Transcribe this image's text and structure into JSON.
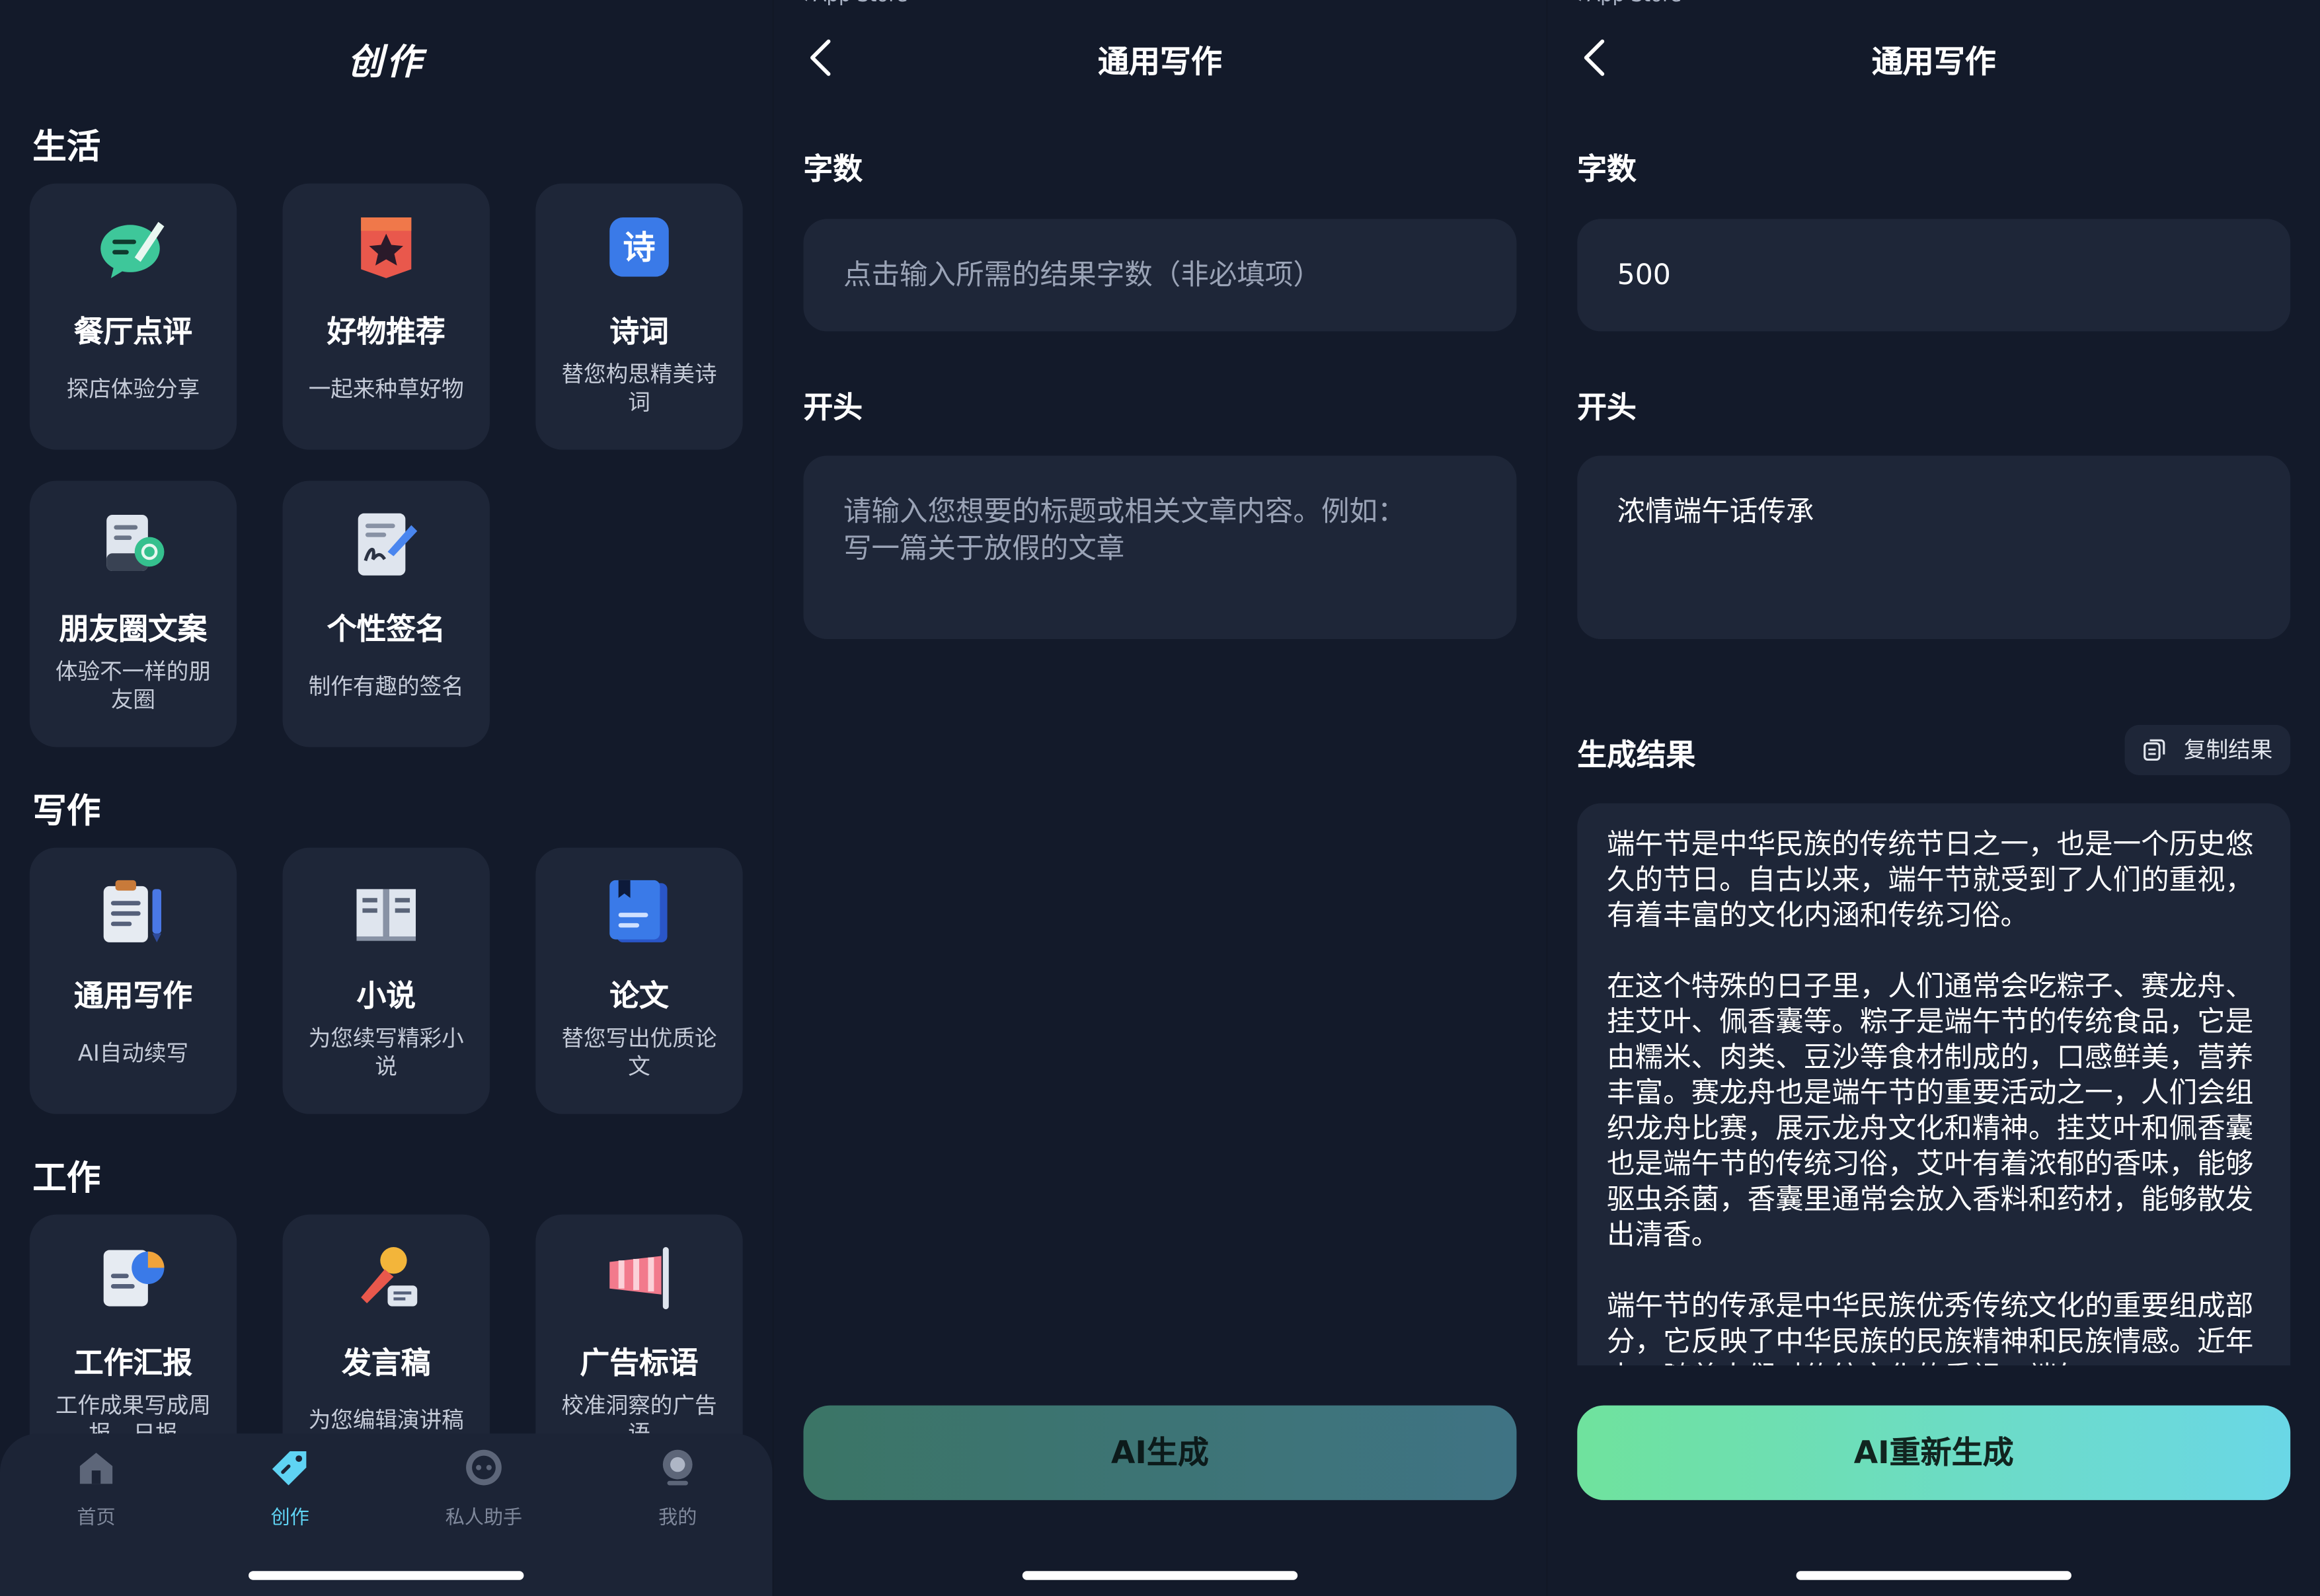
{
  "status": {
    "back_app": "App Store"
  },
  "create_page": {
    "title": "创作",
    "sections": [
      {
        "title": "生活",
        "cards": [
          {
            "title": "餐厅点评",
            "subtitle": "探店体验分享",
            "icon": "chat-edit-icon"
          },
          {
            "title": "好物推荐",
            "subtitle": "一起来种草好物",
            "icon": "star-badge-icon"
          },
          {
            "title": "诗词",
            "subtitle": "替您构思精美诗词",
            "icon": "poem-icon"
          },
          {
            "title": "朋友圈文案",
            "subtitle": "体验不一样的朋友圈",
            "icon": "moments-doc-icon"
          },
          {
            "title": "个性签名",
            "subtitle": "制作有趣的签名",
            "icon": "signature-icon"
          }
        ]
      },
      {
        "title": "写作",
        "cards": [
          {
            "title": "通用写作",
            "subtitle": "AI自动续写",
            "icon": "clipboard-pen-icon"
          },
          {
            "title": "小说",
            "subtitle": "为您续写精彩小说",
            "icon": "open-book-icon"
          },
          {
            "title": "论文",
            "subtitle": "替您写出优质论文",
            "icon": "thesis-book-icon"
          }
        ]
      },
      {
        "title": "工作",
        "cards": [
          {
            "title": "工作汇报",
            "subtitle": "工作成果写成周报、日报",
            "icon": "report-chart-icon"
          },
          {
            "title": "发言稿",
            "subtitle": "为您编辑演讲稿",
            "icon": "microphone-icon"
          },
          {
            "title": "广告标语",
            "subtitle": "校准洞察的广告语",
            "icon": "banner-flag-icon"
          }
        ]
      }
    ],
    "tabs": [
      {
        "label": "首页",
        "icon": "home-icon"
      },
      {
        "label": "创作",
        "icon": "tag-icon",
        "active": true
      },
      {
        "label": "私人助手",
        "icon": "robot-icon"
      },
      {
        "label": "我的",
        "icon": "profile-icon"
      }
    ]
  },
  "writing_empty": {
    "title": "通用写作",
    "word_count_label": "字数",
    "word_count_placeholder": "点击输入所需的结果字数（非必填项）",
    "opening_label": "开头",
    "opening_placeholder_1": "请输入您想要的标题或相关文章内容。例如：",
    "opening_placeholder_2": "写一篇关于放假的文章",
    "generate_button": "AI生成"
  },
  "writing_result": {
    "title": "通用写作",
    "word_count_label": "字数",
    "word_count_value": "500",
    "opening_label": "开头",
    "opening_value": "浓情端午话传承",
    "result_label": "生成结果",
    "copy_button": "复制结果",
    "paragraphs": [
      "端午节是中华民族的传统节日之一，也是一个历史悠久的节日。自古以来，端午节就受到了人们的重视，有着丰富的文化内涵和传统习俗。",
      "在这个特殊的日子里，人们通常会吃粽子、赛龙舟、挂艾叶、佩香囊等。粽子是端午节的传统食品，它是由糯米、肉类、豆沙等食材制成的，口感鲜美，营养丰富。赛龙舟也是端午节的重要活动之一，人们会组织龙舟比赛，展示龙舟文化和精神。挂艾叶和佩香囊也是端午节的传统习俗，艾叶有着浓郁的香味，能够驱虫杀菌，香囊里通常会放入香料和药材，能够散发出清香。",
      "端午节的传承是中华民族优秀传统文化的重要组成部分，它反映了中华民族的民族精神和民族情感。近年来，随着人们对传统文化的重视，端午"
    ],
    "regenerate_button": "AI重新生成"
  },
  "colors": {
    "accent_tab": "#5fd3f3",
    "btn_green": "#6fe29d",
    "btn_cyan": "#6ad7e6",
    "card_bg": "#1e2638"
  }
}
